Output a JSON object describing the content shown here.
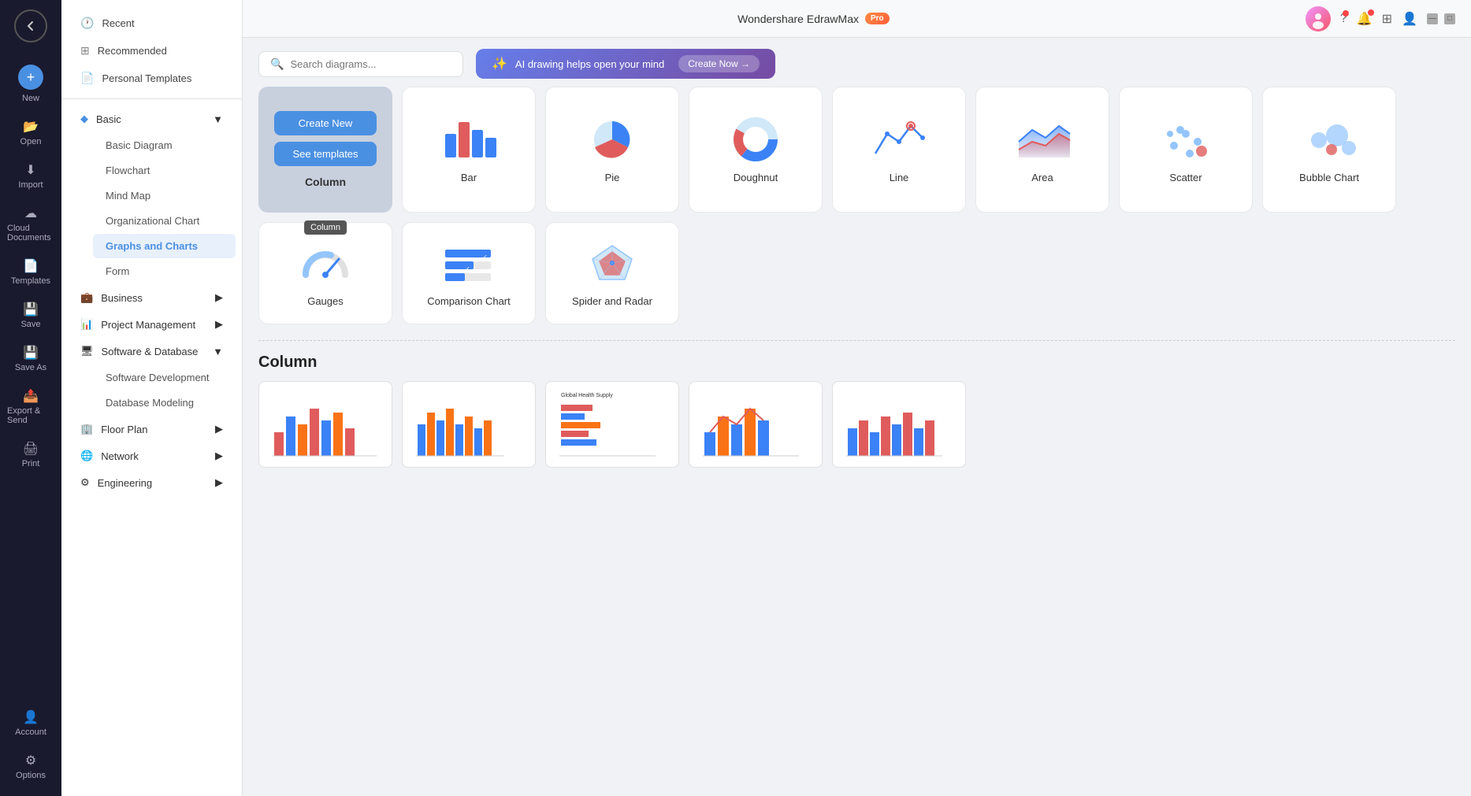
{
  "app": {
    "title": "Wondershare EdrawMax",
    "pro_badge": "Pro",
    "window_controls": {
      "minimize": "—",
      "maximize": "□"
    }
  },
  "header": {
    "search_placeholder": "Search diagrams...",
    "ai_banner_text": "AI drawing helps open your mind",
    "ai_banner_cta": "Create Now →",
    "icons": [
      "help-icon",
      "bell-icon",
      "grid-icon",
      "user-icon"
    ]
  },
  "narrow_nav": {
    "items": [
      {
        "id": "new",
        "label": "New",
        "icon": "+"
      },
      {
        "id": "open",
        "label": "Open",
        "icon": "📂"
      },
      {
        "id": "import",
        "label": "Import",
        "icon": "⬇"
      },
      {
        "id": "cloud",
        "label": "Cloud Documents",
        "icon": "☁"
      },
      {
        "id": "templates",
        "label": "Templates",
        "icon": "📄"
      },
      {
        "id": "save",
        "label": "Save",
        "icon": "💾"
      },
      {
        "id": "save-as",
        "label": "Save As",
        "icon": "💾"
      },
      {
        "id": "export",
        "label": "Export & Send",
        "icon": "📤"
      },
      {
        "id": "print",
        "label": "Print",
        "icon": "🖨"
      }
    ],
    "bottom_items": [
      {
        "id": "account",
        "label": "Account",
        "icon": "👤"
      },
      {
        "id": "options",
        "label": "Options",
        "icon": "⚙"
      }
    ]
  },
  "sidebar": {
    "sections": [
      {
        "id": "recent",
        "label": "Recent",
        "icon": "🕐",
        "expandable": false
      },
      {
        "id": "recommended",
        "label": "Recommended",
        "icon": "⊞",
        "expandable": false
      },
      {
        "id": "personal",
        "label": "Personal Templates",
        "icon": "📄",
        "expandable": false
      }
    ],
    "categories": [
      {
        "id": "basic",
        "label": "Basic",
        "icon": "◆",
        "expanded": true,
        "children": [
          {
            "id": "basic-diagram",
            "label": "Basic Diagram",
            "active": false
          },
          {
            "id": "flowchart",
            "label": "Flowchart",
            "active": false
          },
          {
            "id": "mind-map",
            "label": "Mind Map",
            "active": false
          },
          {
            "id": "org-chart",
            "label": "Organizational Chart",
            "active": false
          },
          {
            "id": "graphs-charts",
            "label": "Graphs and Charts",
            "active": true
          },
          {
            "id": "form",
            "label": "Form",
            "active": false
          }
        ]
      },
      {
        "id": "business",
        "label": "Business",
        "icon": "💼",
        "expanded": false
      },
      {
        "id": "project",
        "label": "Project Management",
        "icon": "📊",
        "expanded": false
      },
      {
        "id": "software",
        "label": "Software & Database",
        "icon": "🖥",
        "expanded": true,
        "children": [
          {
            "id": "software-dev",
            "label": "Software Development"
          },
          {
            "id": "database",
            "label": "Database Modeling"
          }
        ]
      },
      {
        "id": "floor-plan",
        "label": "Floor Plan",
        "icon": "🏢",
        "expanded": false
      },
      {
        "id": "network",
        "label": "Network",
        "icon": "🌐",
        "expanded": false
      },
      {
        "id": "engineering",
        "label": "Engineering",
        "icon": "⚙",
        "expanded": false
      }
    ]
  },
  "chart_grid": {
    "tooltip": "Column",
    "cards": [
      {
        "id": "bar",
        "label": "Bar",
        "type": "bar"
      },
      {
        "id": "pie",
        "label": "Pie",
        "type": "pie"
      },
      {
        "id": "doughnut",
        "label": "Doughnut",
        "type": "doughnut"
      },
      {
        "id": "line",
        "label": "Line",
        "type": "line"
      },
      {
        "id": "area",
        "label": "Area",
        "type": "area"
      },
      {
        "id": "scatter",
        "label": "Scatter",
        "type": "scatter"
      },
      {
        "id": "bubble",
        "label": "Bubble Chart",
        "type": "bubble"
      },
      {
        "id": "gauges",
        "label": "Gauges",
        "type": "gauges"
      },
      {
        "id": "comparison",
        "label": "Comparison Chart",
        "type": "comparison"
      },
      {
        "id": "spider",
        "label": "Spider and Radar",
        "type": "spider"
      }
    ],
    "first_card": {
      "btn_create": "Create New",
      "btn_templates": "See templates",
      "label": "Column"
    }
  },
  "section": {
    "title": "Column"
  },
  "colors": {
    "blue": "#4a90e2",
    "red": "#e05c5c",
    "accent_blue": "#3b82f6",
    "light_blue": "#93c5fd",
    "orange": "#f97316",
    "purple": "#667eea",
    "pro_gradient_start": "#ff8c42",
    "pro_gradient_end": "#ff5e3a"
  }
}
